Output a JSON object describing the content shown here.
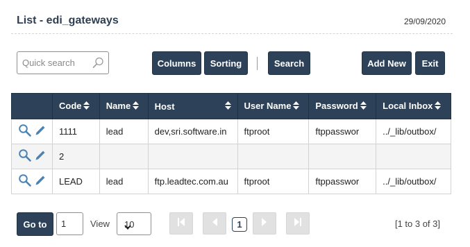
{
  "header": {
    "title": "List - edi_gateways",
    "date": "29/09/2020"
  },
  "toolbar": {
    "search_placeholder": "Quick search",
    "columns_label": "Columns",
    "sorting_label": "Sorting",
    "search_label": "Search",
    "add_new_label": "Add New",
    "exit_label": "Exit"
  },
  "table": {
    "columns": [
      "Code",
      "Name",
      "Host",
      "User Name",
      "Password",
      "Local Inbox"
    ],
    "rows": [
      {
        "code": "1111",
        "name": "lead",
        "host": "dev,sri.software.in",
        "user_name": "ftproot",
        "password": "ftppasswor",
        "local_inbox": "../_lib/outbox/"
      },
      {
        "code": "2",
        "name": "",
        "host": "",
        "user_name": "",
        "password": "",
        "local_inbox": ""
      },
      {
        "code": "LEAD",
        "name": "lead",
        "host": "ftp.leadtec.com.au",
        "user_name": "ftproot",
        "password": "ftppasswor",
        "local_inbox": "../_lib/outbox/"
      }
    ]
  },
  "pagination": {
    "goto_label": "Go to",
    "goto_value": "1",
    "view_label": "View",
    "view_selected": "10",
    "current_page": "1",
    "range_info": "[1 to 3 of 3]"
  },
  "colors": {
    "primary": "#2d4258",
    "title": "#2e3f52",
    "action_icon": "#4a84b5",
    "disabled": "#e1e1e1"
  },
  "icons": {
    "search": "magnifier-icon",
    "view_record": "view-magnifier-icon",
    "edit_record": "pencil-icon",
    "sort": "sort-updown-icon",
    "first": "first-page-icon",
    "prev": "prev-page-icon",
    "next": "next-page-icon",
    "last": "last-page-icon"
  }
}
